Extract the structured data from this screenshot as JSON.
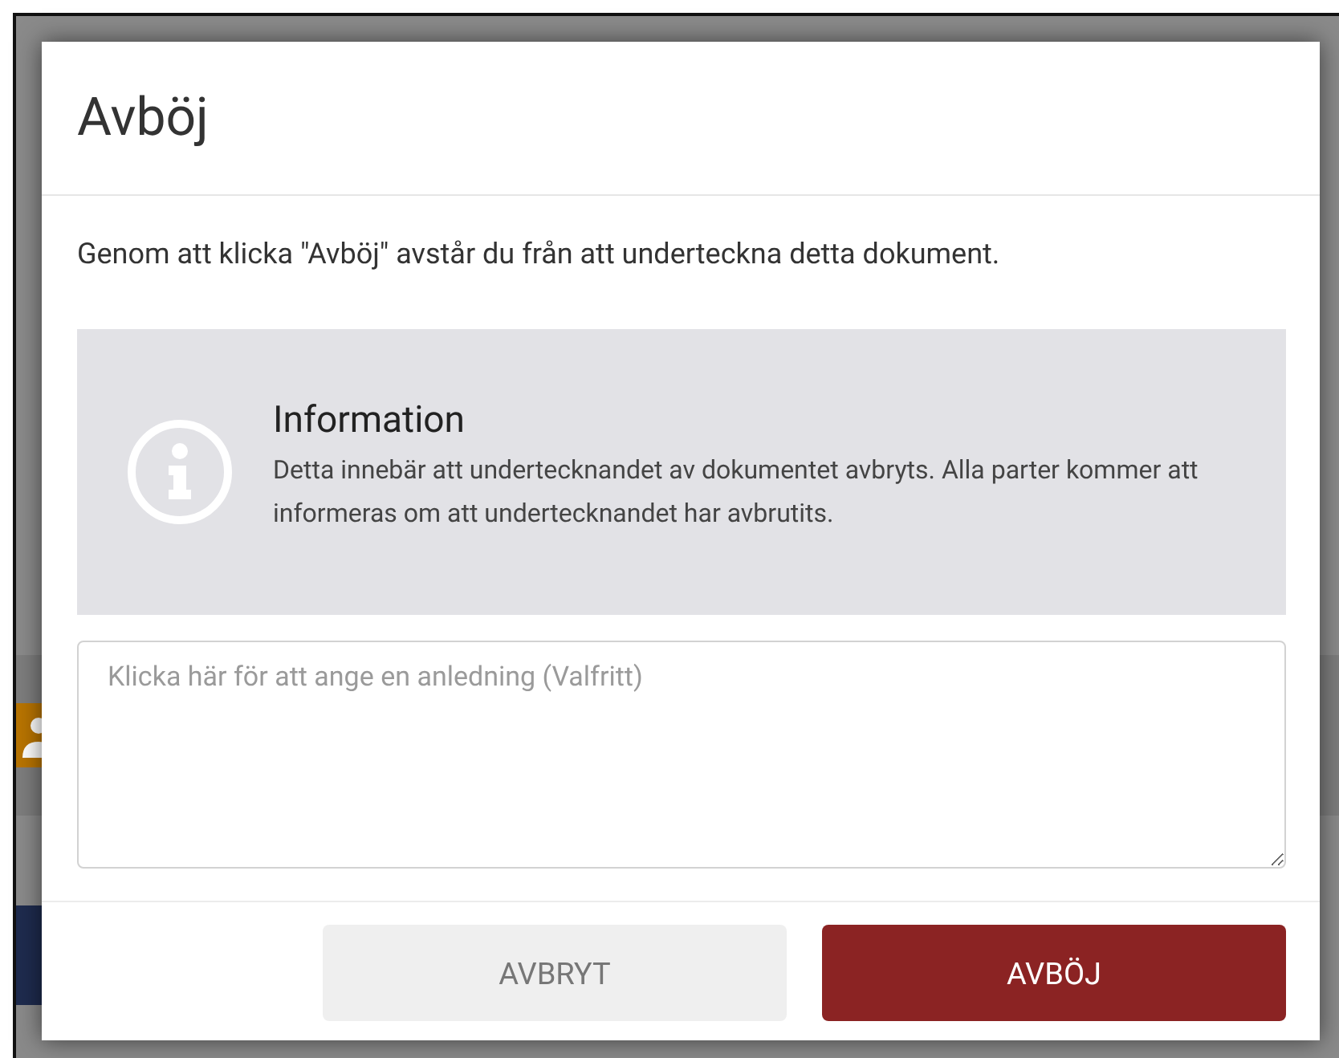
{
  "dialog": {
    "title": "Avböj",
    "message": "Genom att klicka \"Avböj\" avstår du från att underteckna detta dokument.",
    "info": {
      "title": "Information",
      "text": "Detta innebär att undertecknandet av dokumentet avbryts. Alla parter kommer att informeras om att undertecknandet har avbrutits."
    },
    "reason_field": {
      "placeholder": "Klicka här för att ange en anledning (Valfritt)"
    },
    "buttons": [
      {
        "label": "AVBRYT",
        "kind": "secondary"
      },
      {
        "label": "AVBÖJ",
        "kind": "primary"
      }
    ]
  }
}
